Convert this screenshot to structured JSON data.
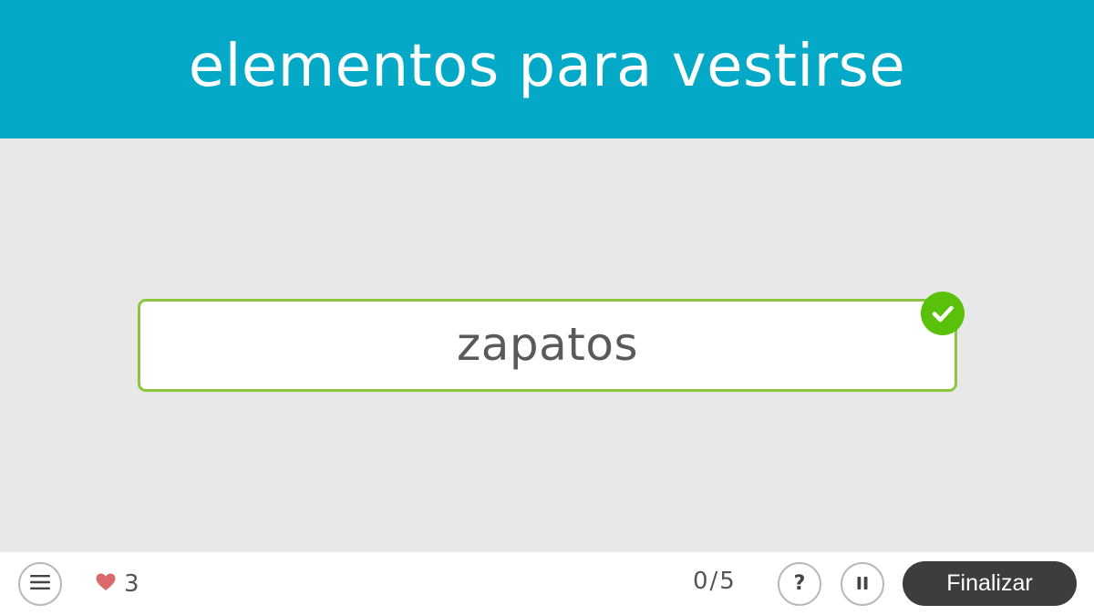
{
  "header": {
    "title": "elementos para vestirse"
  },
  "main": {
    "answer": "zapatos",
    "status_icon": "check-icon",
    "colors": {
      "header_bg": "#03a9c6",
      "correct_border": "#8cc63f",
      "correct_badge": "#5ac10a"
    }
  },
  "footer": {
    "menu_icon": "hamburger-icon",
    "lives_icon": "heart-icon",
    "lives": "3",
    "progress": "0/5",
    "help_label": "?",
    "pause_icon": "pause-icon",
    "finish_label": "Finalizar"
  }
}
